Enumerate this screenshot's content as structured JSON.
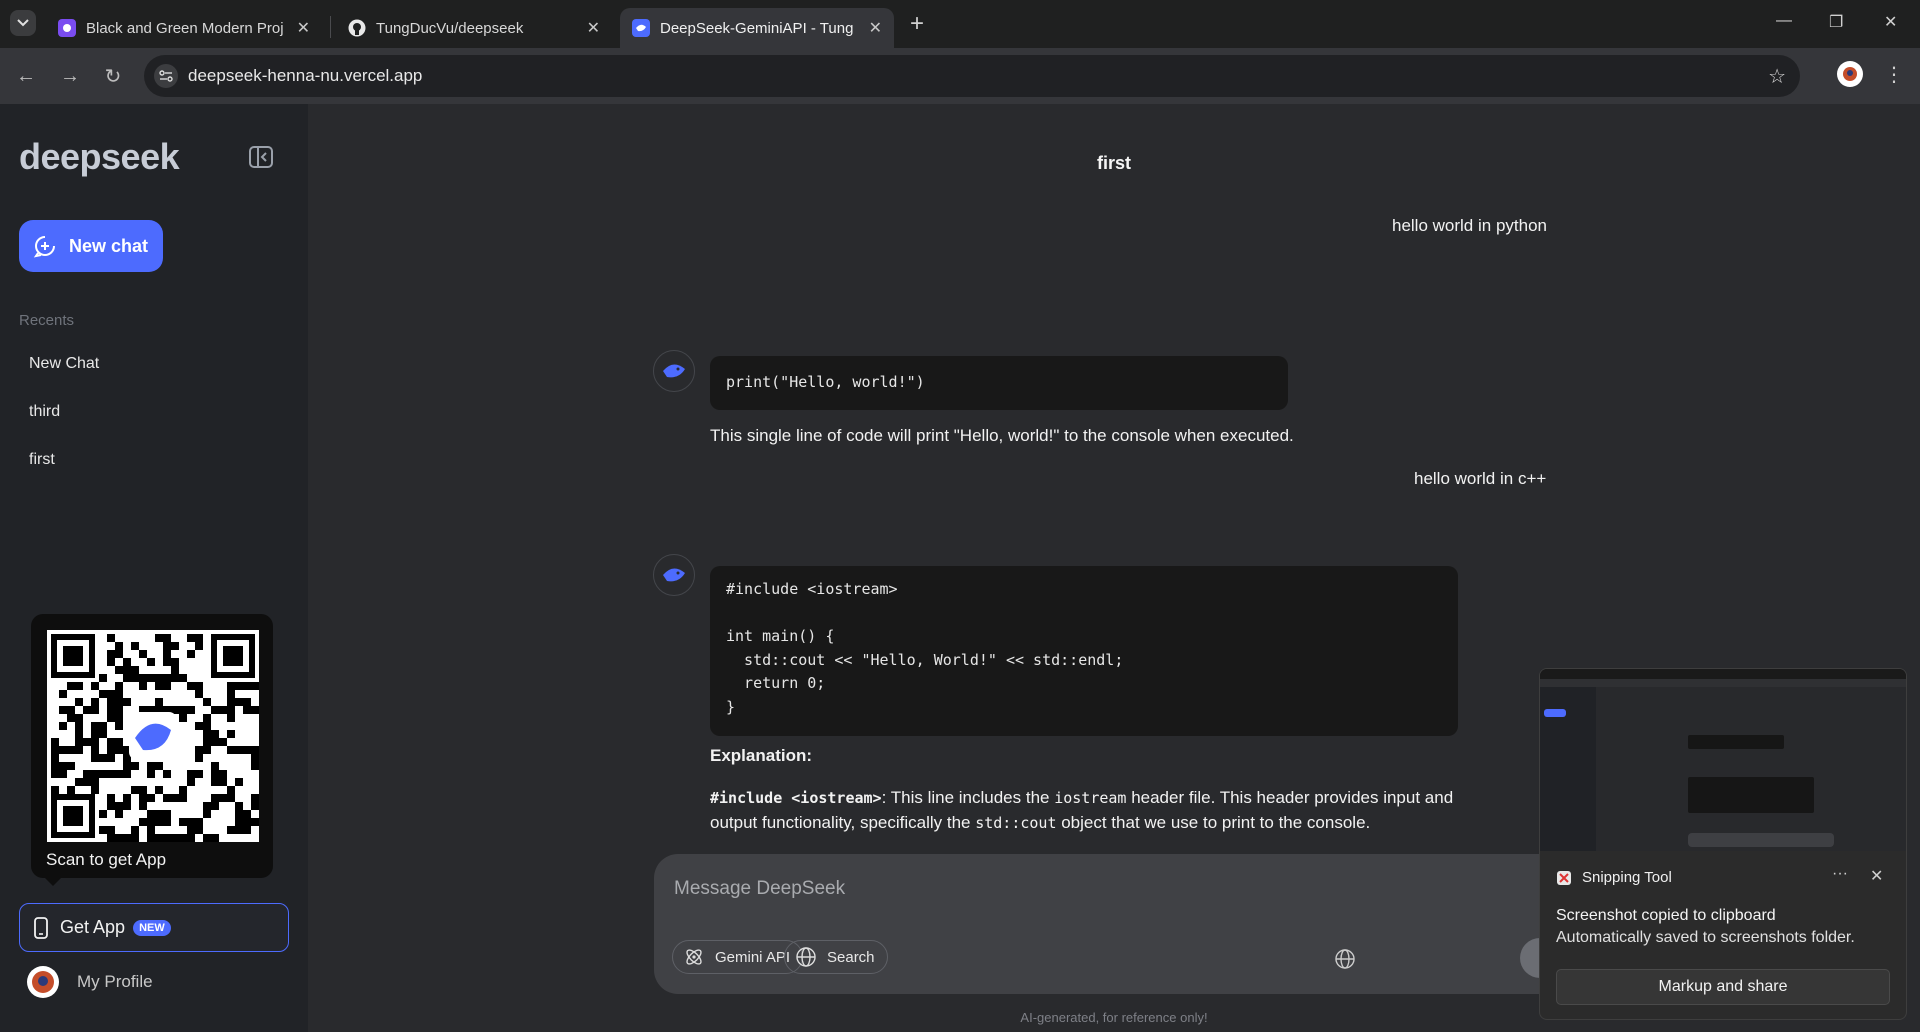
{
  "browser": {
    "tabs": [
      {
        "title": "Black and Green Modern Projec",
        "favicon": "canva-icon"
      },
      {
        "title": "TungDucVu/deepseek",
        "favicon": "github-icon"
      },
      {
        "title": "DeepSeek-GeminiAPI - Tung Du",
        "favicon": "deepseek-icon",
        "active": true
      }
    ],
    "url": "deepseek-henna-nu.vercel.app"
  },
  "sidebar": {
    "logo": "deepseek",
    "new_chat_label": "New chat",
    "recents_label": "Recents",
    "recents": [
      "New Chat",
      "third",
      "first"
    ],
    "qr_caption": "Scan to get App",
    "get_app_label": "Get App",
    "get_app_badge": "NEW",
    "profile_label": "My Profile"
  },
  "chat": {
    "title": "first",
    "messages": [
      {
        "role": "user",
        "text": "hello world in python"
      },
      {
        "role": "assistant",
        "code": "print(\"Hello, world!\")",
        "text": "This single line of code will print \"Hello, world!\" to the console when executed."
      },
      {
        "role": "user",
        "text": "hello world in c++"
      },
      {
        "role": "assistant",
        "code": "#include <iostream>\n\nint main() {\n  std::cout << \"Hello, World!\" << std::endl;\n  return 0;\n}",
        "heading": "Explanation:",
        "para_code": "#include <iostream>",
        "para_1": ": This line includes the ",
        "para_code2": "iostream",
        "para_2": " header file. This header provides input and output functionality, specifically the ",
        "para_code3": "std::cout",
        "para_3": " object that we use to print to the console."
      }
    ]
  },
  "composer": {
    "placeholder": "Message DeepSeek",
    "gemini_label": "Gemini API",
    "search_label": "Search"
  },
  "footnote": "AI-generated, for reference only!",
  "snipping_tool": {
    "app": "Snipping Tool",
    "line1": "Screenshot copied to clipboard",
    "line2": "Automatically saved to screenshots folder.",
    "action": "Markup and share"
  },
  "colors": {
    "accent": "#4d6bfe",
    "sidebar_bg": "#212327",
    "main_bg": "#292a2d"
  }
}
